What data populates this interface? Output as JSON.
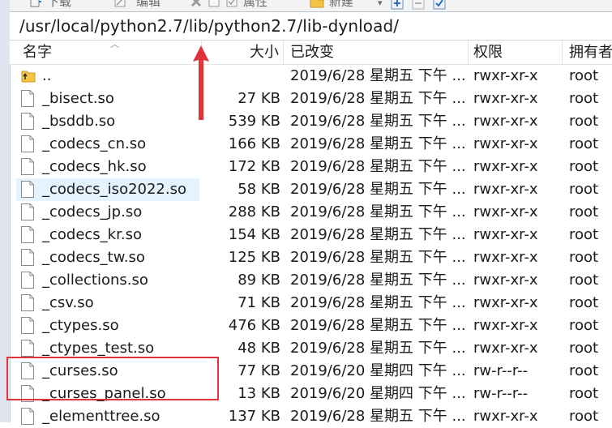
{
  "toolbar": {
    "download": "下载",
    "edit": "编辑",
    "properties": "属性",
    "new": "新建"
  },
  "path": "/usr/local/python2.7/lib/python2.7/lib-dynload/",
  "columns": {
    "name": "名字",
    "size": "大小",
    "modified": "已改变",
    "permissions": "权限",
    "owner": "拥有者"
  },
  "files": [
    {
      "name": "..",
      "size": "",
      "modified": "2019/6/28 星期五 下午 ...",
      "perms": "rwxr-xr-x",
      "owner": "root",
      "kind": "up"
    },
    {
      "name": "_bisect.so",
      "size": "27 KB",
      "modified": "2019/6/28 星期五 下午 ...",
      "perms": "rwxr-xr-x",
      "owner": "root",
      "kind": "file"
    },
    {
      "name": "_bsddb.so",
      "size": "539 KB",
      "modified": "2019/6/28 星期五 下午 ...",
      "perms": "rwxr-xr-x",
      "owner": "root",
      "kind": "file"
    },
    {
      "name": "_codecs_cn.so",
      "size": "166 KB",
      "modified": "2019/6/28 星期五 下午 ...",
      "perms": "rwxr-xr-x",
      "owner": "root",
      "kind": "file"
    },
    {
      "name": "_codecs_hk.so",
      "size": "172 KB",
      "modified": "2019/6/28 星期五 下午 ...",
      "perms": "rwxr-xr-x",
      "owner": "root",
      "kind": "file"
    },
    {
      "name": "_codecs_iso2022.so",
      "size": "58 KB",
      "modified": "2019/6/28 星期五 下午 ...",
      "perms": "rwxr-xr-x",
      "owner": "root",
      "kind": "file",
      "hover": true
    },
    {
      "name": "_codecs_jp.so",
      "size": "288 KB",
      "modified": "2019/6/28 星期五 下午 ...",
      "perms": "rwxr-xr-x",
      "owner": "root",
      "kind": "file"
    },
    {
      "name": "_codecs_kr.so",
      "size": "154 KB",
      "modified": "2019/6/28 星期五 下午 ...",
      "perms": "rwxr-xr-x",
      "owner": "root",
      "kind": "file"
    },
    {
      "name": "_codecs_tw.so",
      "size": "125 KB",
      "modified": "2019/6/28 星期五 下午 ...",
      "perms": "rwxr-xr-x",
      "owner": "root",
      "kind": "file"
    },
    {
      "name": "_collections.so",
      "size": "89 KB",
      "modified": "2019/6/28 星期五 下午 ...",
      "perms": "rwxr-xr-x",
      "owner": "root",
      "kind": "file"
    },
    {
      "name": "_csv.so",
      "size": "71 KB",
      "modified": "2019/6/28 星期五 下午 ...",
      "perms": "rwxr-xr-x",
      "owner": "root",
      "kind": "file"
    },
    {
      "name": "_ctypes.so",
      "size": "476 KB",
      "modified": "2019/6/28 星期五 下午 ...",
      "perms": "rwxr-xr-x",
      "owner": "root",
      "kind": "file"
    },
    {
      "name": "_ctypes_test.so",
      "size": "48 KB",
      "modified": "2019/6/28 星期五 下午 ...",
      "perms": "rwxr-xr-x",
      "owner": "root",
      "kind": "file"
    },
    {
      "name": "_curses.so",
      "size": "77 KB",
      "modified": "2019/6/20 星期四 下午 ...",
      "perms": "rw-r--r--",
      "owner": "root",
      "kind": "file"
    },
    {
      "name": "_curses_panel.so",
      "size": "13 KB",
      "modified": "2019/6/20 星期四 下午 ...",
      "perms": "rw-r--r--",
      "owner": "root",
      "kind": "file"
    },
    {
      "name": "_elementtree.so",
      "size": "137 KB",
      "modified": "2019/6/28 星期五 下午 ...",
      "perms": "rwxr-xr-x",
      "owner": "root",
      "kind": "file"
    }
  ],
  "colors": {
    "hover_bg": "#e5f3ff",
    "annotation_red": "#e0333a"
  }
}
